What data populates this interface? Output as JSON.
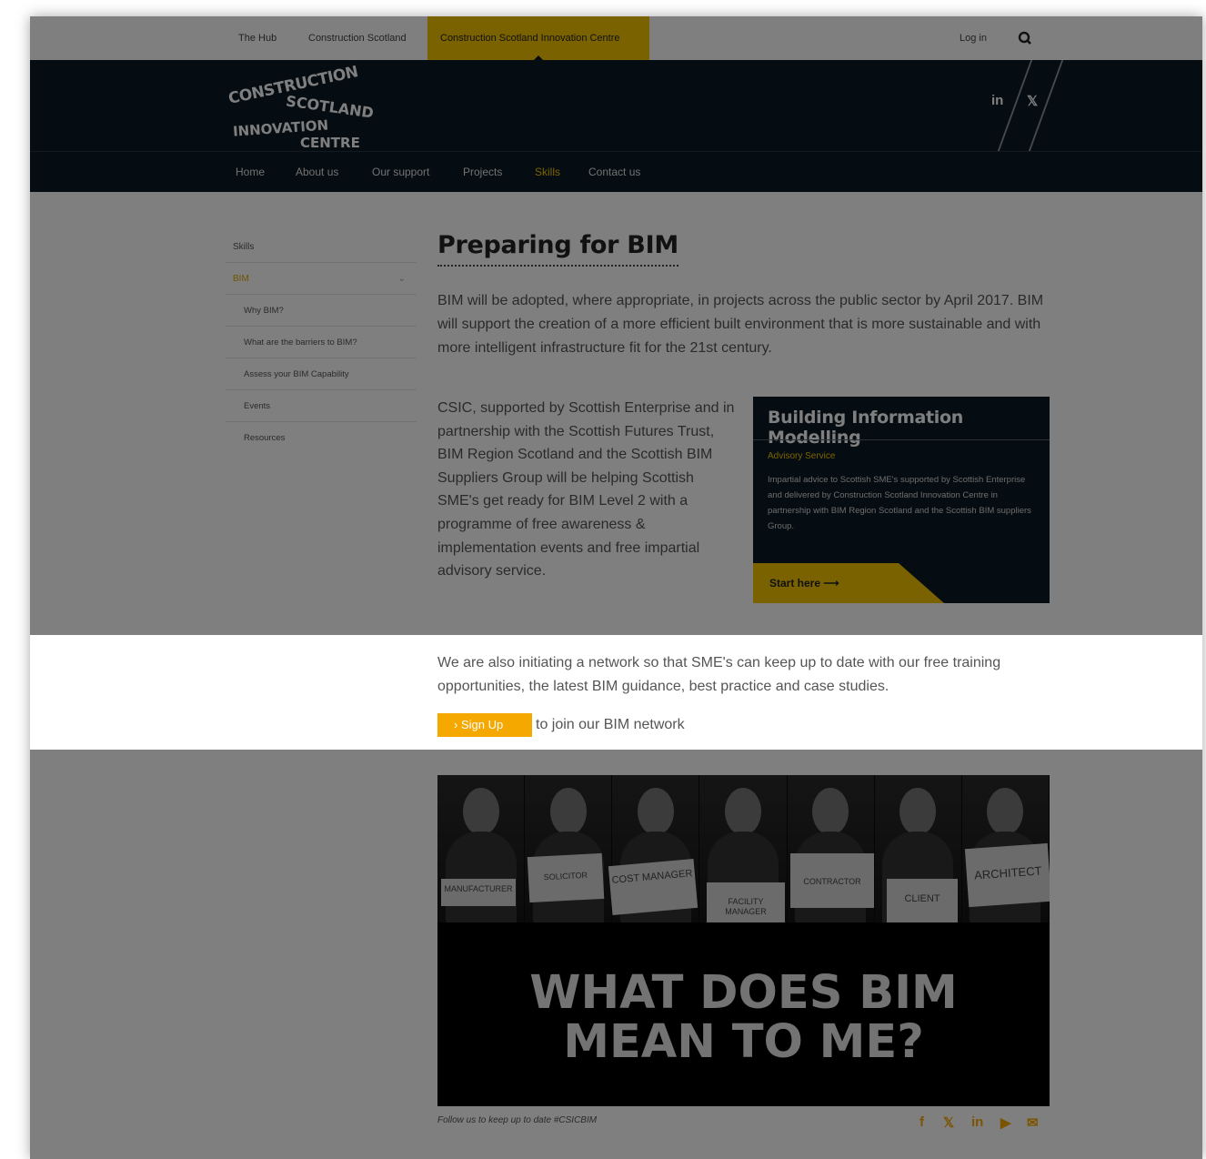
{
  "utilbar": {
    "tabs": [
      "The Hub",
      "Construction Scotland",
      "Construction Scotland Innovation Centre"
    ],
    "login_label": "Log in"
  },
  "header": {
    "logo": [
      "CONSTRUCTION",
      "SCOTLAND",
      "INNOVATION",
      "CENTRE"
    ],
    "social": {
      "linkedin": "in",
      "twitter": "𝕏"
    }
  },
  "nav": [
    "Home",
    "About us",
    "Our support",
    "Projects",
    "Skills",
    "Contact us"
  ],
  "sidebar": {
    "items": [
      {
        "label": "Skills",
        "active": false,
        "sub": false
      },
      {
        "label": "BIM",
        "active": true,
        "sub": false
      },
      {
        "label": "Why BIM?",
        "active": false,
        "sub": true
      },
      {
        "label": "What are the barriers to BIM?",
        "active": false,
        "sub": true
      },
      {
        "label": "Assess your BIM Capability",
        "active": false,
        "sub": true
      },
      {
        "label": "Events",
        "active": false,
        "sub": true
      },
      {
        "label": "Resources",
        "active": false,
        "sub": true
      }
    ]
  },
  "main": {
    "title": "Preparing for BIM",
    "para1": "BIM will be adopted, where appropriate, in projects across the public sector by April 2017. BIM will support the creation of a more efficient built environment that is more sustainable and with more intelligent infrastructure fit for the 21st century.",
    "para2": "CSIC, supported by Scottish Enterprise and in partnership with the Scottish Futures Trust, BIM Region Scotland and the Scottish BIM Suppliers Group will be helping Scottish SME's get ready for BIM Level 2 with a programme of free awareness & implementation events and free impartial advisory service.",
    "para3": "We are also initiating a network so that SME's can keep up to date with our free training opportunities, the latest BIM guidance, best practice and case studies.",
    "signup_label": "› Sign Up",
    "signup_text": "to join our BIM network"
  },
  "bim_card": {
    "title": "Building Information Modelling",
    "subtitle": "Advisory Service",
    "description": "Impartial advice to Scottish SME's supported by Scottish Enterprise and delivered by Construction Scotland Innovation Centre in partnership with BIM Region Scotland and the Scottish BIM suppliers Group.",
    "cta_label": "Start here ⟶"
  },
  "video": {
    "signs": [
      "MANUFACTURER",
      "SOLICITOR",
      "COST MANAGER",
      "FACILITY MANAGER",
      "CONTRACTOR",
      "CLIENT",
      "ARCHITECT"
    ],
    "line1": "WHAT DOES BIM",
    "line2": "MEAN TO ME?"
  },
  "footer": {
    "follow": "Follow us to keep up to date #CSICBIM",
    "share_icons": [
      "f",
      "𝕏",
      "in",
      "▶",
      "✉"
    ]
  },
  "colors": {
    "accent": "#f5c400",
    "dark": "#0d1a24",
    "signup": "#f5a800"
  }
}
